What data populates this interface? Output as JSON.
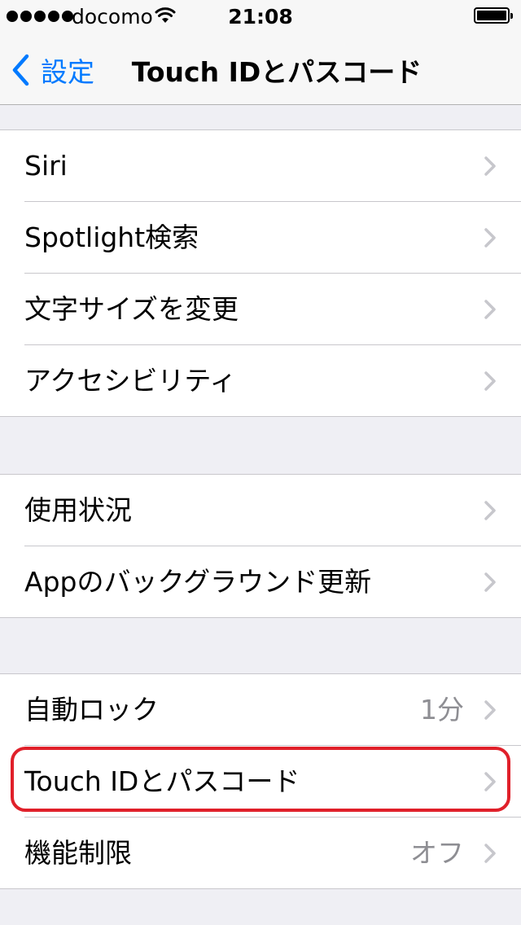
{
  "status_bar": {
    "carrier": "docomo",
    "time": "21:08",
    "icons": [
      "signal-dots-icon",
      "wifi-icon",
      "battery-icon"
    ]
  },
  "nav": {
    "back_label": "設定",
    "title": "Touch IDとパスコード"
  },
  "groups": [
    {
      "items": [
        {
          "label": "Siri",
          "value": ""
        },
        {
          "label": "Spotlight検索",
          "value": ""
        },
        {
          "label": "文字サイズを変更",
          "value": ""
        },
        {
          "label": "アクセシビリティ",
          "value": ""
        }
      ]
    },
    {
      "items": [
        {
          "label": "使用状況",
          "value": ""
        },
        {
          "label": "Appのバックグラウンド更新",
          "value": ""
        }
      ]
    },
    {
      "items": [
        {
          "label": "自動ロック",
          "value": "1分"
        },
        {
          "label": "Touch IDとパスコード",
          "value": "",
          "highlighted": true
        },
        {
          "label": "機能制限",
          "value": "オフ"
        }
      ]
    }
  ],
  "colors": {
    "accent": "#007aff",
    "highlight": "#e0202a",
    "background": "#efeff4",
    "secondary_text": "#8e8e93"
  }
}
